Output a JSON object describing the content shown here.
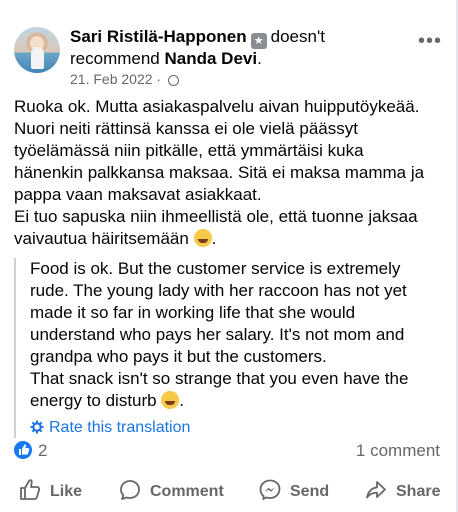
{
  "post": {
    "author": "Sari Ristilä-Happonen",
    "action": "doesn't",
    "action2": "recommend",
    "page_name": "Nanda Devi",
    "date": "21. Feb 2022",
    "dot": " · ",
    "original_text": [
      "Ruoka ok. Mutta asiakaspalvelu aivan huipputöykeää.",
      "Nuori neiti rättinsä kanssa ei ole vielä päässyt",
      "työelämässä niin pitkälle, että ymmärtäisi kuka",
      "hänenkin palkkansa maksaa. Sitä ei maksa mamma ja",
      "pappa vaan maksavat asiakkaat.",
      "Ei tuo sapuska niin ihmeellistä ole, että tuonne jaksaa",
      "vaivautua häiritsemään"
    ],
    "translation_text": [
      "Food is ok. But the customer service is extremely",
      "rude. The young lady with her raccoon has not yet",
      "made it so far in working life that she would",
      "understand who pays her salary. It's not mom and",
      "grandpa who pays it but the customers.",
      "That snack isn't so strange that you even have the",
      "energy to disturb"
    ],
    "rate_label": "Rate this translation",
    "reaction_count": "2",
    "comment_count": "1 comment"
  },
  "actions": {
    "like": "Like",
    "comment": "Comment",
    "send": "Send",
    "share": "Share"
  },
  "icons": {
    "more": "more-horizontal-icon",
    "globe": "globe-icon",
    "badge": "star-badge-icon",
    "emoji": "laughing-emoji-icon",
    "like_reaction": "like-reaction-icon"
  },
  "colors": {
    "link": "#1b74e4",
    "secondary": "#65676b",
    "like": "#1877f2"
  }
}
